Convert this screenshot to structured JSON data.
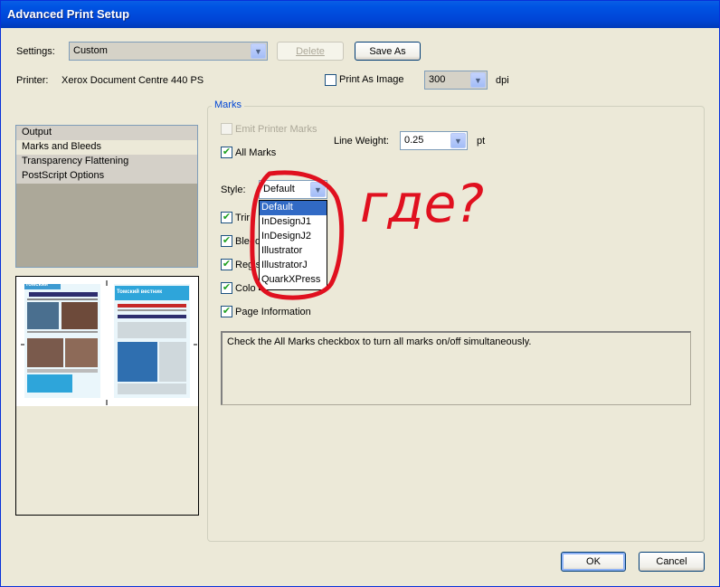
{
  "window": {
    "title": "Advanced Print Setup"
  },
  "settings": {
    "label": "Settings:",
    "value": "Custom",
    "delete_label": "Delete",
    "save_as_label": "Save As"
  },
  "printer": {
    "label": "Printer:",
    "value": "Xerox Document Centre 440 PS",
    "print_as_image_label": "Print As Image",
    "print_as_image_checked": false,
    "dpi_value": "300",
    "dpi_label": "dpi"
  },
  "sidebar": {
    "items": [
      {
        "label": "Output"
      },
      {
        "label": "Marks and Bleeds"
      },
      {
        "label": "Transparency Flattening"
      },
      {
        "label": "PostScript Options"
      }
    ],
    "selected": 1
  },
  "marks": {
    "group_label": "Marks",
    "emit_printer_marks_label": "Emit Printer Marks",
    "emit_printer_marks_enabled": false,
    "all_marks_label": "All Marks",
    "line_weight_label": "Line Weight:",
    "line_weight_value": "0.25",
    "line_weight_unit": "pt",
    "style_label": "Style:",
    "style_value": "Default",
    "style_options": [
      "Default",
      "InDesignJ1",
      "InDesignJ2",
      "Illustrator",
      "IllustratorJ",
      "QuarkXPress"
    ],
    "checkbox_labels": [
      "Trim Marks",
      "Bleed Marks",
      "Registration Marks",
      "Color Bars",
      "Page Information"
    ],
    "checkbox_visible_text": [
      "Trir",
      "Bleed",
      "Regis",
      "Colo",
      "Page Information"
    ]
  },
  "description": "Check the All Marks checkbox to turn all marks on/off simultaneously.",
  "buttons": {
    "ok_label": "OK",
    "cancel_label": "Cancel"
  },
  "annotation": {
    "text": "где?",
    "color": "#e0101f"
  },
  "preview": {
    "masthead_left": "Томский",
    "masthead_right": "Томский вестник"
  }
}
